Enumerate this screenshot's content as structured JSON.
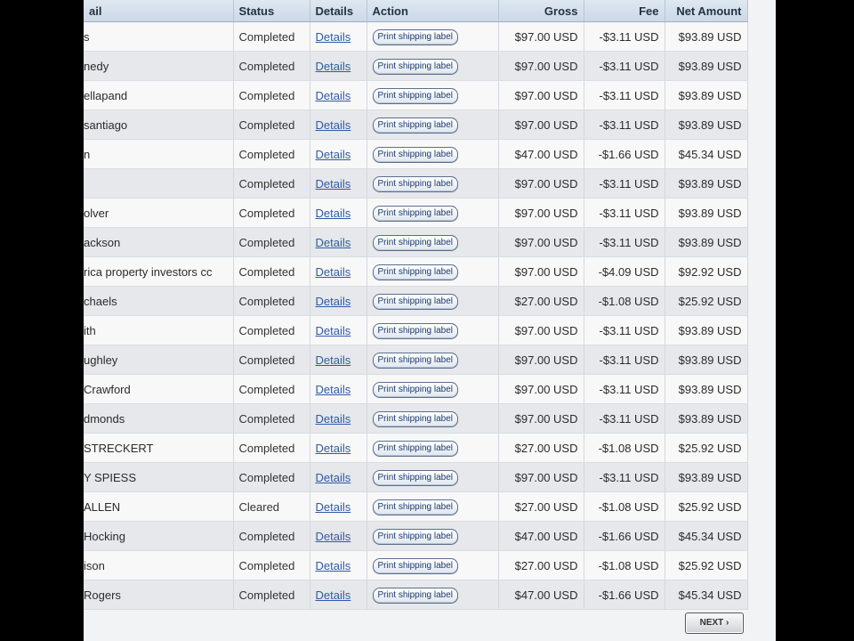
{
  "columns": {
    "email": "ail",
    "status": "Status",
    "details": "Details",
    "action": "Action",
    "gross": "Gross",
    "fee": "Fee",
    "net": "Net Amount"
  },
  "action_label": "Print shipping label",
  "details_label": "Details",
  "rows": [
    {
      "name": "s",
      "status": "Completed",
      "gross": "$97.00 USD",
      "fee": "-$3.11 USD",
      "net": "$93.89 USD"
    },
    {
      "name": "nedy",
      "status": "Completed",
      "gross": "$97.00 USD",
      "fee": "-$3.11 USD",
      "net": "$93.89 USD"
    },
    {
      "name": "ellapand",
      "status": "Completed",
      "gross": "$97.00 USD",
      "fee": "-$3.11 USD",
      "net": "$93.89 USD"
    },
    {
      "name": "santiago",
      "status": "Completed",
      "gross": "$97.00 USD",
      "fee": "-$3.11 USD",
      "net": "$93.89 USD"
    },
    {
      "name": "n",
      "status": "Completed",
      "gross": "$47.00 USD",
      "fee": "-$1.66 USD",
      "net": "$45.34 USD"
    },
    {
      "name": "",
      "status": "Completed",
      "gross": "$97.00 USD",
      "fee": "-$3.11 USD",
      "net": "$93.89 USD"
    },
    {
      "name": "olver",
      "status": "Completed",
      "gross": "$97.00 USD",
      "fee": "-$3.11 USD",
      "net": "$93.89 USD"
    },
    {
      "name": "ackson",
      "status": "Completed",
      "gross": "$97.00 USD",
      "fee": "-$3.11 USD",
      "net": "$93.89 USD"
    },
    {
      "name": "rica property investors cc",
      "status": "Completed",
      "gross": "$97.00 USD",
      "fee": "-$4.09 USD",
      "net": "$92.92 USD"
    },
    {
      "name": "chaels",
      "status": "Completed",
      "gross": "$27.00 USD",
      "fee": "-$1.08 USD",
      "net": "$25.92 USD"
    },
    {
      "name": "ith",
      "status": "Completed",
      "gross": "$97.00 USD",
      "fee": "-$3.11 USD",
      "net": "$93.89 USD"
    },
    {
      "name": "ughley",
      "status": "Completed",
      "gross": "$97.00 USD",
      "fee": "-$3.11 USD",
      "net": "$93.89 USD"
    },
    {
      "name": "Crawford",
      "status": "Completed",
      "gross": "$97.00 USD",
      "fee": "-$3.11 USD",
      "net": "$93.89 USD"
    },
    {
      "name": "dmonds",
      "status": "Completed",
      "gross": "$97.00 USD",
      "fee": "-$3.11 USD",
      "net": "$93.89 USD"
    },
    {
      "name": "STRECKERT",
      "status": "Completed",
      "gross": "$27.00 USD",
      "fee": "-$1.08 USD",
      "net": "$25.92 USD"
    },
    {
      "name": "Y SPIESS",
      "status": "Completed",
      "gross": "$97.00 USD",
      "fee": "-$3.11 USD",
      "net": "$93.89 USD"
    },
    {
      "name": "ALLEN",
      "status": "Cleared",
      "gross": "$27.00 USD",
      "fee": "-$1.08 USD",
      "net": "$25.92 USD"
    },
    {
      "name": "Hocking",
      "status": "Completed",
      "gross": "$47.00 USD",
      "fee": "-$1.66 USD",
      "net": "$45.34 USD"
    },
    {
      "name": "ison",
      "status": "Completed",
      "gross": "$27.00 USD",
      "fee": "-$1.08 USD",
      "net": "$25.92 USD"
    },
    {
      "name": "Rogers",
      "status": "Completed",
      "gross": "$47.00 USD",
      "fee": "-$1.66 USD",
      "net": "$45.34 USD"
    }
  ],
  "pagination": {
    "next_label": "NEXT ›"
  }
}
